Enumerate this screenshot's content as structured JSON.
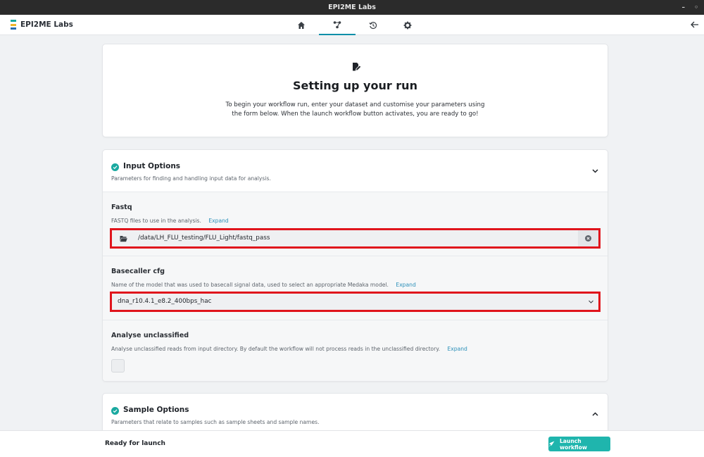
{
  "window": {
    "title": "EPI2ME Labs"
  },
  "app": {
    "brand": "EPI2ME Labs"
  },
  "nav": {
    "items": [
      {
        "icon": "home-icon"
      },
      {
        "icon": "workflow-icon"
      },
      {
        "icon": "history-icon"
      },
      {
        "icon": "gear-icon"
      }
    ],
    "active": "workflow-icon",
    "back_icon": "back-arrow-icon"
  },
  "hero": {
    "icon": "edit-document-icon",
    "title": "Setting up your run",
    "description": "To begin your workflow run, enter your dataset and customise your parameters using the form below. When the launch workflow button activates, you are ready to go!"
  },
  "input_options": {
    "title": "Input Options",
    "description": "Parameters for finding and handling input data for analysis.",
    "fastq": {
      "label": "Fastq",
      "description": "FASTQ files to use in the analysis.",
      "expand": "Expand",
      "value": "/data/LH_FLU_testing/FLU_Light/fastq_pass"
    },
    "basecaller": {
      "label": "Basecaller cfg",
      "description": "Name of the model that was used to basecall signal data, used to select an appropriate Medaka model.",
      "expand": "Expand",
      "value": "dna_r10.4.1_e8.2_400bps_hac"
    },
    "unclassified": {
      "label": "Analyse unclassified",
      "description": "Analyse unclassified reads from input directory. By default the workflow will not process reads in the unclassified directory.",
      "expand": "Expand",
      "checked": false
    }
  },
  "sample_options": {
    "title": "Sample Options",
    "description": "Parameters that relate to samples such as sample sheets and sample names."
  },
  "footer": {
    "status": "Ready for launch",
    "launch_label": "Launch workflow"
  },
  "colors": {
    "accent": "#0b8fa8",
    "success": "#1aa9a0",
    "launch": "#1fb5ad",
    "highlight": "#e0141c",
    "link": "#2a8fb8"
  }
}
